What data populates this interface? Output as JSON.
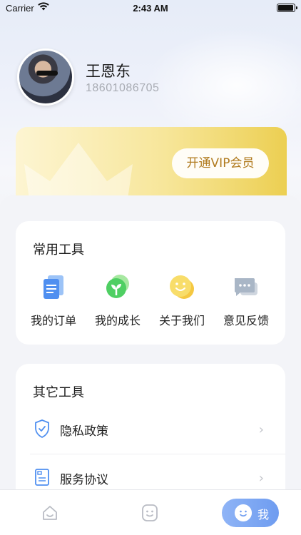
{
  "status_bar": {
    "carrier": "Carrier",
    "time": "2:43 AM"
  },
  "profile": {
    "name": "王恩东",
    "phone": "18601086705"
  },
  "vip": {
    "button_label": "开通VIP会员"
  },
  "common_tools": {
    "title": "常用工具",
    "items": [
      {
        "label": "我的订单",
        "icon": "document-icon"
      },
      {
        "label": "我的成长",
        "icon": "sprout-icon"
      },
      {
        "label": "关于我们",
        "icon": "smiley-coin-icon"
      },
      {
        "label": "意见反馈",
        "icon": "chat-bubble-icon"
      }
    ]
  },
  "other_tools": {
    "title": "其它工具",
    "items": [
      {
        "label": "隐私政策",
        "icon": "shield-icon"
      },
      {
        "label": "服务协议",
        "icon": "agreement-doc-icon"
      }
    ]
  },
  "tabbar": {
    "me_label": "我"
  },
  "colors": {
    "accent": "#6e9cf0",
    "vip_gold": "#eccf52",
    "vip_text": "#b07a1e"
  }
}
